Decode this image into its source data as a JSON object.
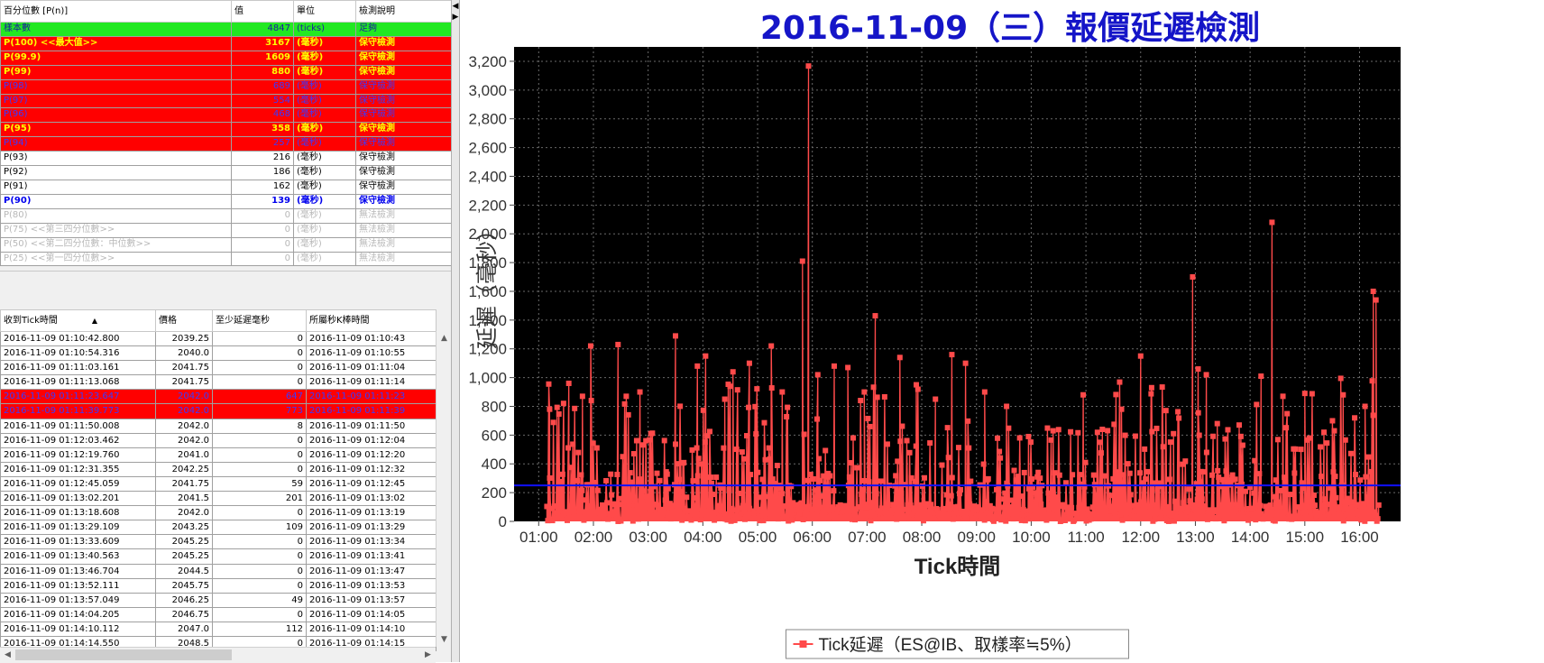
{
  "percentile_table": {
    "headers": [
      "百分位數 [P(n)]",
      "值",
      "單位",
      "檢測說明"
    ],
    "rows": [
      {
        "label": "樣本數",
        "value": "4847",
        "unit": "(ticks)",
        "note": "足夠",
        "style": "green"
      },
      {
        "label": "P(100)  <<最大值>>",
        "value": "3167",
        "unit": "(毫秒)",
        "note": "保守檢測",
        "style": "red-y"
      },
      {
        "label": "P(99.9)",
        "value": "1609",
        "unit": "(毫秒)",
        "note": "保守檢測",
        "style": "red-y"
      },
      {
        "label": "P(99)",
        "value": "880",
        "unit": "(毫秒)",
        "note": "保守檢測",
        "style": "red-y"
      },
      {
        "label": "P(98)",
        "value": "689",
        "unit": "(毫秒)",
        "note": "保守檢測",
        "style": "red-b"
      },
      {
        "label": "P(97)",
        "value": "554",
        "unit": "(毫秒)",
        "note": "保守檢測",
        "style": "red-b"
      },
      {
        "label": "P(96)",
        "value": "468",
        "unit": "(毫秒)",
        "note": "保守檢測",
        "style": "red-b"
      },
      {
        "label": "P(95)",
        "value": "358",
        "unit": "(毫秒)",
        "note": "保守檢測",
        "style": "red-y"
      },
      {
        "label": "P(94)",
        "value": "257",
        "unit": "(毫秒)",
        "note": "保守檢測",
        "style": "red-b"
      },
      {
        "label": "P(93)",
        "value": "216",
        "unit": "(毫秒)",
        "note": "保守檢測",
        "style": "white"
      },
      {
        "label": "P(92)",
        "value": "186",
        "unit": "(毫秒)",
        "note": "保守檢測",
        "style": "white"
      },
      {
        "label": "P(91)",
        "value": "162",
        "unit": "(毫秒)",
        "note": "保守檢測",
        "style": "white"
      },
      {
        "label": "P(90)",
        "value": "139",
        "unit": "(毫秒)",
        "note": "保守檢測",
        "style": "blue"
      },
      {
        "label": "P(80)",
        "value": "0",
        "unit": "(毫秒)",
        "note": "無法檢測",
        "style": "gray"
      },
      {
        "label": "P(75)  <<第三四分位數>>",
        "value": "0",
        "unit": "(毫秒)",
        "note": "無法檢測",
        "style": "gray"
      },
      {
        "label": "P(50)  <<第二四分位數：中位數>>",
        "value": "0",
        "unit": "(毫秒)",
        "note": "無法檢測",
        "style": "gray"
      },
      {
        "label": "P(25)  <<第一四分位數>>",
        "value": "0",
        "unit": "(毫秒)",
        "note": "無法檢測",
        "style": "gray"
      }
    ]
  },
  "tick_table": {
    "headers": [
      "收到Tick時間",
      "價格",
      "至少延遲毫秒",
      "所屬秒K棒時間"
    ],
    "rows": [
      {
        "time": "2016-11-09 01:10:42.800",
        "price": "2039.25",
        "delay": "0",
        "bar": "2016-11-09 01:10:43",
        "hl": false
      },
      {
        "time": "2016-11-09 01:10:54.316",
        "price": "2040.0",
        "delay": "0",
        "bar": "2016-11-09 01:10:55",
        "hl": false
      },
      {
        "time": "2016-11-09 01:11:03.161",
        "price": "2041.75",
        "delay": "0",
        "bar": "2016-11-09 01:11:04",
        "hl": false
      },
      {
        "time": "2016-11-09 01:11:13.068",
        "price": "2041.75",
        "delay": "0",
        "bar": "2016-11-09 01:11:14",
        "hl": false
      },
      {
        "time": "2016-11-09 01:11:23.647",
        "price": "2042.0",
        "delay": "647",
        "bar": "2016-11-09 01:11:23",
        "hl": true
      },
      {
        "time": "2016-11-09 01:11:39.773",
        "price": "2042.0",
        "delay": "773",
        "bar": "2016-11-09 01:11:39",
        "hl": true
      },
      {
        "time": "2016-11-09 01:11:50.008",
        "price": "2042.0",
        "delay": "8",
        "bar": "2016-11-09 01:11:50",
        "hl": false
      },
      {
        "time": "2016-11-09 01:12:03.462",
        "price": "2042.0",
        "delay": "0",
        "bar": "2016-11-09 01:12:04",
        "hl": false
      },
      {
        "time": "2016-11-09 01:12:19.760",
        "price": "2041.0",
        "delay": "0",
        "bar": "2016-11-09 01:12:20",
        "hl": false
      },
      {
        "time": "2016-11-09 01:12:31.355",
        "price": "2042.25",
        "delay": "0",
        "bar": "2016-11-09 01:12:32",
        "hl": false
      },
      {
        "time": "2016-11-09 01:12:45.059",
        "price": "2041.75",
        "delay": "59",
        "bar": "2016-11-09 01:12:45",
        "hl": false
      },
      {
        "time": "2016-11-09 01:13:02.201",
        "price": "2041.5",
        "delay": "201",
        "bar": "2016-11-09 01:13:02",
        "hl": false
      },
      {
        "time": "2016-11-09 01:13:18.608",
        "price": "2042.0",
        "delay": "0",
        "bar": "2016-11-09 01:13:19",
        "hl": false
      },
      {
        "time": "2016-11-09 01:13:29.109",
        "price": "2043.25",
        "delay": "109",
        "bar": "2016-11-09 01:13:29",
        "hl": false
      },
      {
        "time": "2016-11-09 01:13:33.609",
        "price": "2045.25",
        "delay": "0",
        "bar": "2016-11-09 01:13:34",
        "hl": false
      },
      {
        "time": "2016-11-09 01:13:40.563",
        "price": "2045.25",
        "delay": "0",
        "bar": "2016-11-09 01:13:41",
        "hl": false
      },
      {
        "time": "2016-11-09 01:13:46.704",
        "price": "2044.5",
        "delay": "0",
        "bar": "2016-11-09 01:13:47",
        "hl": false
      },
      {
        "time": "2016-11-09 01:13:52.111",
        "price": "2045.75",
        "delay": "0",
        "bar": "2016-11-09 01:13:53",
        "hl": false
      },
      {
        "time": "2016-11-09 01:13:57.049",
        "price": "2046.25",
        "delay": "49",
        "bar": "2016-11-09 01:13:57",
        "hl": false
      },
      {
        "time": "2016-11-09 01:14:04.205",
        "price": "2046.75",
        "delay": "0",
        "bar": "2016-11-09 01:14:05",
        "hl": false
      },
      {
        "time": "2016-11-09 01:14:10.112",
        "price": "2047.0",
        "delay": "112",
        "bar": "2016-11-09 01:14:10",
        "hl": false
      },
      {
        "time": "2016-11-09 01:14:14.550",
        "price": "2048.5",
        "delay": "0",
        "bar": "2016-11-09 01:14:15",
        "hl": false
      }
    ]
  },
  "scroll_icons": {
    "up": "scroll-up-icon",
    "down": "scroll-down-icon",
    "left": "scroll-left-icon",
    "right": "scroll-right-icon"
  },
  "chart_data": {
    "type": "line",
    "title": "2016-11-09（三）報價延遲檢測",
    "xlabel": "Tick時間",
    "ylabel": "延遲（毫秒）",
    "x_ticks": [
      "01:00",
      "02:00",
      "03:00",
      "04:00",
      "05:00",
      "06:00",
      "07:00",
      "08:00",
      "09:00",
      "10:00",
      "11:00",
      "12:00",
      "13:00",
      "14:00",
      "15:00",
      "16:00"
    ],
    "ylim": [
      0,
      3300
    ],
    "y_ticks": [
      "0",
      "200",
      "400",
      "600",
      "800",
      "1,000",
      "1,200",
      "1,400",
      "1,600",
      "1,800",
      "2,000",
      "2,200",
      "2,400",
      "2,600",
      "2,800",
      "3,000",
      "3,200"
    ],
    "grid": true,
    "background": "#000000",
    "series_color": "#ff4a4a",
    "reference_line": {
      "value": 250,
      "color": "#1010ff"
    },
    "legend": {
      "label": "Tick延遲（ES@IB、取樣率≒5%）",
      "placement": "bottom-center"
    },
    "peaks": [
      {
        "x": 1.2,
        "y": 780
      },
      {
        "x": 1.55,
        "y": 960
      },
      {
        "x": 1.8,
        "y": 870
      },
      {
        "x": 1.95,
        "y": 1220
      },
      {
        "x": 2.45,
        "y": 1230
      },
      {
        "x": 2.6,
        "y": 870
      },
      {
        "x": 2.85,
        "y": 900
      },
      {
        "x": 3.05,
        "y": 610
      },
      {
        "x": 3.5,
        "y": 1290
      },
      {
        "x": 3.9,
        "y": 1080
      },
      {
        "x": 4.05,
        "y": 1150
      },
      {
        "x": 4.4,
        "y": 850
      },
      {
        "x": 4.55,
        "y": 1040
      },
      {
        "x": 4.85,
        "y": 1100
      },
      {
        "x": 5.25,
        "y": 1220
      },
      {
        "x": 5.45,
        "y": 900
      },
      {
        "x": 5.82,
        "y": 1810
      },
      {
        "x": 5.93,
        "y": 3167
      },
      {
        "x": 6.1,
        "y": 1020
      },
      {
        "x": 6.4,
        "y": 1080
      },
      {
        "x": 6.65,
        "y": 1070
      },
      {
        "x": 6.95,
        "y": 900
      },
      {
        "x": 7.15,
        "y": 1430
      },
      {
        "x": 7.6,
        "y": 1140
      },
      {
        "x": 7.9,
        "y": 950
      },
      {
        "x": 8.25,
        "y": 850
      },
      {
        "x": 8.55,
        "y": 1160
      },
      {
        "x": 8.8,
        "y": 1100
      },
      {
        "x": 9.15,
        "y": 900
      },
      {
        "x": 9.55,
        "y": 800
      },
      {
        "x": 9.95,
        "y": 590
      },
      {
        "x": 10.4,
        "y": 630
      },
      {
        "x": 10.95,
        "y": 880
      },
      {
        "x": 11.3,
        "y": 640
      },
      {
        "x": 11.65,
        "y": 780
      },
      {
        "x": 12.0,
        "y": 1150
      },
      {
        "x": 12.2,
        "y": 930
      },
      {
        "x": 12.6,
        "y": 610
      },
      {
        "x": 12.95,
        "y": 1700
      },
      {
        "x": 13.05,
        "y": 1060
      },
      {
        "x": 13.2,
        "y": 1020
      },
      {
        "x": 13.4,
        "y": 680
      },
      {
        "x": 13.8,
        "y": 670
      },
      {
        "x": 14.2,
        "y": 1010
      },
      {
        "x": 14.4,
        "y": 2080
      },
      {
        "x": 14.6,
        "y": 870
      },
      {
        "x": 15.0,
        "y": 890
      },
      {
        "x": 15.35,
        "y": 620
      },
      {
        "x": 15.7,
        "y": 880
      },
      {
        "x": 16.1,
        "y": 800
      },
      {
        "x": 16.25,
        "y": 1600
      },
      {
        "x": 16.3,
        "y": 1540
      }
    ]
  }
}
